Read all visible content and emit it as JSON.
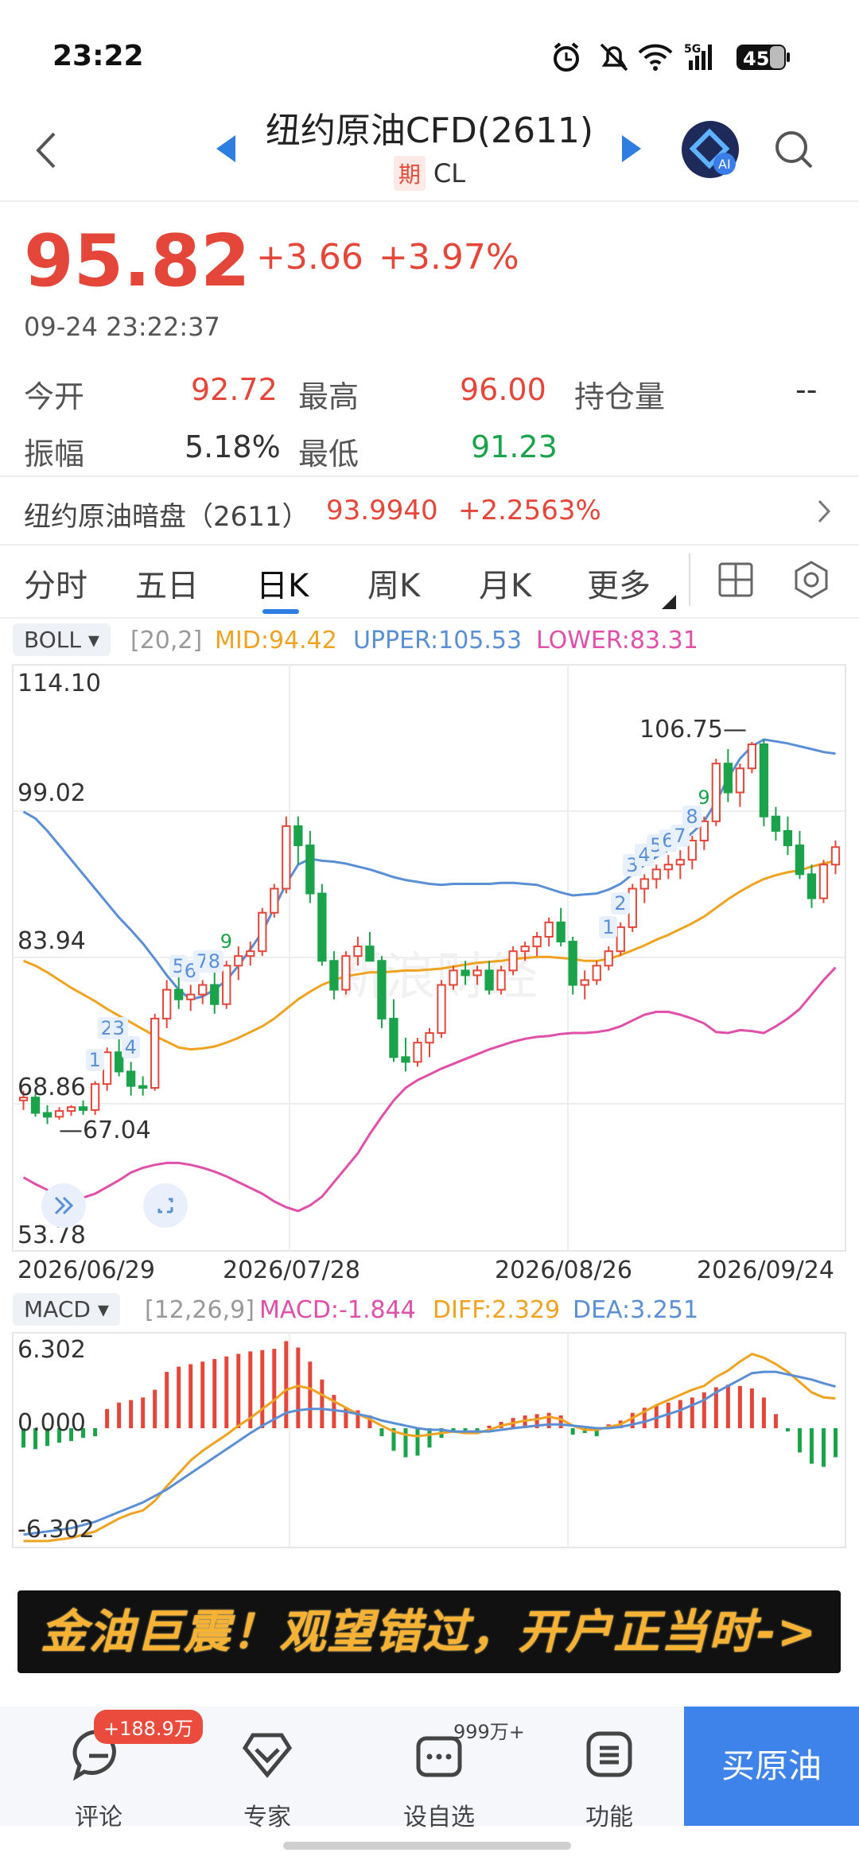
{
  "status_bar": {
    "time": "23:22",
    "battery": "45",
    "network": "5G"
  },
  "header": {
    "title": "纽约原油CFD(2611)",
    "tag": "期",
    "symbol": "CL"
  },
  "quote": {
    "price": "95.82",
    "change": "+3.66",
    "change_pct": "+3.97%",
    "timestamp": "09-24 23:22:37",
    "open_label": "今开",
    "open": "92.72",
    "high_label": "最高",
    "high": "96.00",
    "oi_label": "持仓量",
    "oi": "--",
    "amp_label": "振幅",
    "amp": "5.18%",
    "low_label": "最低",
    "low": "91.23"
  },
  "dark_pool": {
    "name": "纽约原油暗盘（2611）",
    "price": "93.9940",
    "change": "+2.2563%"
  },
  "tabs": [
    {
      "label": "分时"
    },
    {
      "label": "五日"
    },
    {
      "label": "日K"
    },
    {
      "label": "周K"
    },
    {
      "label": "月K"
    },
    {
      "label": "更多"
    }
  ],
  "boll": {
    "name": "BOLL",
    "params": "[20,2]",
    "mid": "MID:94.42",
    "upper": "UPPER:105.53",
    "lower": "LOWER:83.31"
  },
  "macd": {
    "name": "MACD",
    "params": "[12,26,9]",
    "macd": "MACD:-1.844",
    "diff": "DIFF:2.329",
    "dea": "DEA:3.251"
  },
  "colors": {
    "up": "#e5463a",
    "down": "#1aa34a",
    "upper": "#5a8fd6",
    "mid": "#efa321",
    "lower": "#e04fa8",
    "accent": "#2e7de0"
  },
  "chart_data": [
    {
      "type": "candlestick",
      "title": "",
      "y_ticks": [
        "114.10",
        "99.02",
        "83.94",
        "68.86",
        "53.78"
      ],
      "ylim": [
        53.78,
        114.1
      ],
      "dates": [
        "2026/06/29",
        "2026/07/28",
        "2026/08/26",
        "2026/09/24"
      ],
      "high_label": "106.75",
      "low_label": "67.04",
      "candles": [
        [
          69.5,
          70.5,
          68.5,
          69.8
        ],
        [
          69.8,
          70.2,
          67.8,
          68.2
        ],
        [
          68.2,
          69.0,
          67.04,
          67.8
        ],
        [
          67.8,
          68.8,
          67.5,
          68.4
        ],
        [
          68.4,
          69.0,
          67.9,
          68.8
        ],
        [
          68.8,
          69.5,
          68.0,
          68.5
        ],
        [
          68.5,
          71.5,
          68.0,
          71.2
        ],
        [
          71.2,
          75.0,
          70.5,
          74.5
        ],
        [
          74.5,
          76.0,
          72.0,
          72.5
        ],
        [
          72.5,
          73.5,
          70.0,
          71.0
        ],
        [
          71.0,
          72.0,
          70.0,
          70.8
        ],
        [
          70.8,
          78.5,
          70.5,
          78.0
        ],
        [
          78.0,
          82.0,
          77.0,
          81.0
        ],
        [
          81.0,
          82.5,
          79.0,
          80.0
        ],
        [
          80.0,
          81.5,
          78.8,
          80.5
        ],
        [
          80.5,
          82.0,
          79.5,
          81.5
        ],
        [
          81.5,
          83.0,
          78.5,
          79.5
        ],
        [
          79.5,
          84.0,
          79.0,
          83.5
        ],
        [
          83.5,
          85.5,
          82.0,
          84.5
        ],
        [
          84.5,
          86.0,
          83.5,
          85.0
        ],
        [
          85.0,
          89.5,
          84.5,
          89.0
        ],
        [
          89.0,
          92.0,
          88.5,
          91.5
        ],
        [
          91.5,
          99.0,
          91.0,
          98.0
        ],
        [
          98.0,
          99.0,
          94.0,
          96.0
        ],
        [
          96.0,
          97.5,
          90.0,
          91.0
        ],
        [
          91.0,
          92.0,
          83.5,
          84.0
        ],
        [
          84.0,
          85.0,
          80.0,
          81.0
        ],
        [
          81.0,
          85.0,
          80.5,
          84.5
        ],
        [
          84.5,
          86.5,
          83.5,
          85.5
        ],
        [
          85.5,
          87.0,
          84.0,
          84.0
        ],
        [
          84.0,
          84.5,
          77.0,
          78.0
        ],
        [
          78.0,
          80.0,
          73.5,
          74.0
        ],
        [
          74.0,
          76.0,
          72.5,
          73.5
        ],
        [
          73.5,
          76.0,
          73.0,
          75.5
        ],
        [
          75.5,
          77.0,
          74.0,
          76.5
        ],
        [
          76.5,
          82.0,
          76.0,
          81.5
        ],
        [
          81.5,
          83.5,
          81.0,
          83.0
        ],
        [
          83.0,
          84.0,
          81.5,
          82.5
        ],
        [
          82.5,
          83.5,
          81.5,
          83.0
        ],
        [
          83.0,
          84.0,
          80.5,
          81.0
        ],
        [
          81.0,
          83.5,
          80.5,
          83.0
        ],
        [
          83.0,
          85.5,
          82.5,
          85.0
        ],
        [
          85.0,
          86.0,
          84.0,
          85.5
        ],
        [
          85.5,
          87.0,
          84.5,
          86.5
        ],
        [
          86.5,
          88.5,
          85.5,
          88.0
        ],
        [
          88.0,
          89.5,
          85.5,
          86.0
        ],
        [
          86.0,
          86.5,
          80.5,
          81.5
        ],
        [
          81.5,
          83.0,
          80.0,
          82.0
        ],
        [
          82.0,
          84.0,
          81.5,
          83.5
        ],
        [
          83.5,
          85.5,
          83.0,
          85.0
        ],
        [
          85.0,
          88.0,
          84.5,
          87.5
        ],
        [
          87.5,
          92.0,
          87.0,
          91.5
        ],
        [
          91.5,
          93.0,
          90.0,
          92.5
        ],
        [
          92.5,
          94.0,
          91.5,
          93.5
        ],
        [
          93.5,
          95.0,
          92.5,
          94.0
        ],
        [
          94.0,
          95.5,
          92.5,
          94.5
        ],
        [
          94.5,
          97.0,
          93.5,
          96.5
        ],
        [
          96.5,
          99.0,
          95.5,
          98.5
        ],
        [
          98.5,
          105.0,
          98.0,
          104.5
        ],
        [
          104.5,
          106.0,
          100.5,
          101.5
        ],
        [
          101.5,
          104.5,
          100.0,
          104.0
        ],
        [
          104.0,
          106.75,
          103.5,
          106.5
        ],
        [
          106.5,
          107.0,
          98.0,
          99.0
        ],
        [
          99.0,
          100.0,
          96.5,
          97.5
        ],
        [
          97.5,
          99.0,
          95.0,
          96.0
        ],
        [
          96.0,
          97.5,
          92.5,
          93.0
        ],
        [
          93.0,
          94.0,
          89.5,
          90.5
        ],
        [
          90.5,
          94.5,
          90.0,
          94.0
        ],
        [
          94.0,
          96.5,
          93.0,
          95.82
        ]
      ],
      "upper": [
        99.5,
        98.8,
        97.5,
        96.0,
        94.5,
        93.0,
        91.5,
        90.0,
        88.5,
        87.2,
        85.8,
        84.2,
        82.5,
        81.0,
        80.0,
        80.3,
        81.0,
        82.0,
        83.5,
        85.2,
        87.0,
        89.5,
        92.0,
        94.0,
        94.6,
        94.4,
        94.3,
        94.1,
        93.8,
        93.5,
        93.1,
        92.7,
        92.4,
        92.2,
        92.0,
        91.9,
        92.0,
        92.0,
        92.0,
        92.0,
        92.1,
        92.1,
        92.0,
        91.9,
        91.5,
        91.1,
        90.8,
        90.9,
        91.0,
        91.4,
        92.0,
        93.0,
        94.0,
        94.8,
        95.5,
        96.3,
        97.3,
        98.5,
        100.5,
        103.0,
        105.0,
        106.3,
        107.0,
        106.8,
        106.6,
        106.3,
        106.0,
        105.7,
        105.53
      ],
      "mid": [
        84.0,
        83.5,
        82.8,
        82.0,
        81.2,
        80.5,
        79.8,
        79.0,
        78.3,
        77.6,
        76.9,
        76.2,
        75.6,
        75.0,
        74.8,
        74.9,
        75.1,
        75.5,
        76.0,
        76.6,
        77.2,
        78.0,
        79.0,
        80.0,
        80.8,
        81.5,
        82.0,
        82.4,
        82.6,
        82.8,
        82.8,
        82.9,
        83.0,
        83.0,
        83.1,
        83.2,
        83.4,
        83.6,
        83.8,
        83.9,
        84.0,
        84.2,
        84.3,
        84.4,
        84.4,
        84.3,
        84.2,
        84.0,
        84.0,
        84.2,
        84.6,
        85.1,
        85.6,
        86.2,
        86.7,
        87.3,
        87.9,
        88.6,
        89.5,
        90.4,
        91.2,
        91.9,
        92.5,
        92.9,
        93.2,
        93.4,
        93.8,
        94.1,
        94.42
      ],
      "lower": [
        61.5,
        60.8,
        60.2,
        59.6,
        59.3,
        59.4,
        59.8,
        60.5,
        61.2,
        62.0,
        62.5,
        62.8,
        63.0,
        63.0,
        62.8,
        62.5,
        62.1,
        61.6,
        61.0,
        60.4,
        59.8,
        59.0,
        58.4,
        58.0,
        58.6,
        59.5,
        61.0,
        62.5,
        64.0,
        66.0,
        67.8,
        69.5,
        70.8,
        71.6,
        72.2,
        72.8,
        73.3,
        73.8,
        74.3,
        74.8,
        75.2,
        75.6,
        75.9,
        76.1,
        76.2,
        76.4,
        76.5,
        76.5,
        76.6,
        76.8,
        77.2,
        77.8,
        78.4,
        78.7,
        78.7,
        78.4,
        78.0,
        77.5,
        76.6,
        76.5,
        76.8,
        76.7,
        76.5,
        77.2,
        78.0,
        79.0,
        80.5,
        82.0,
        83.31
      ]
    },
    {
      "type": "bar",
      "title": "",
      "y_ticks": [
        "6.302",
        "0.000",
        "-6.302"
      ],
      "ylim": [
        -6.302,
        6.302
      ],
      "hist": [
        -1.2,
        -1.3,
        -1.1,
        -0.9,
        -0.8,
        -0.6,
        -0.5,
        1.5,
        2.0,
        2.2,
        2.4,
        3.0,
        4.4,
        4.8,
        5.0,
        5.2,
        5.4,
        5.6,
        5.8,
        6.0,
        6.1,
        6.2,
        6.8,
        6.3,
        5.2,
        3.8,
        2.6,
        1.6,
        1.4,
        1.0,
        -0.5,
        -1.4,
        -1.8,
        -1.7,
        -1.2,
        -0.6,
        -0.2,
        -0.2,
        -0.3,
        0.2,
        0.5,
        0.8,
        1.0,
        1.1,
        1.2,
        1.0,
        -0.4,
        -0.3,
        -0.5,
        0.3,
        0.6,
        1.2,
        1.6,
        1.8,
        2.0,
        2.2,
        2.4,
        2.8,
        3.2,
        3.4,
        3.3,
        3.1,
        2.4,
        1.1,
        -0.2,
        -1.5,
        -2.2,
        -2.4,
        -1.8
      ],
      "diff": [
        -7.0,
        -7.0,
        -7.0,
        -6.9,
        -6.8,
        -6.6,
        -6.4,
        -6.0,
        -5.6,
        -5.3,
        -5.1,
        -4.5,
        -3.6,
        -2.8,
        -2.0,
        -1.4,
        -0.9,
        -0.4,
        0.2,
        0.8,
        1.5,
        2.2,
        3.0,
        3.3,
        3.1,
        2.6,
        2.1,
        1.6,
        1.1,
        0.7,
        0.2,
        -0.2,
        -0.4,
        -0.5,
        -0.4,
        -0.3,
        -0.2,
        -0.3,
        -0.3,
        -0.1,
        0.2,
        0.4,
        0.6,
        0.7,
        0.9,
        0.7,
        0.2,
        -0.1,
        -0.1,
        0.1,
        0.3,
        0.8,
        1.3,
        1.8,
        2.2,
        2.6,
        3.0,
        3.3,
        4.0,
        4.5,
        5.2,
        5.8,
        5.5,
        5.0,
        4.4,
        3.6,
        2.8,
        2.4,
        2.33
      ],
      "dea": [
        -6.6,
        -6.5,
        -6.4,
        -6.3,
        -6.2,
        -6.0,
        -5.8,
        -5.5,
        -5.2,
        -4.9,
        -4.6,
        -4.2,
        -3.8,
        -3.3,
        -2.8,
        -2.3,
        -1.8,
        -1.3,
        -0.8,
        -0.3,
        0.2,
        0.7,
        1.2,
        1.4,
        1.5,
        1.5,
        1.4,
        1.3,
        1.1,
        0.9,
        0.6,
        0.4,
        0.2,
        0.0,
        -0.1,
        -0.1,
        -0.2,
        -0.2,
        -0.2,
        -0.2,
        -0.1,
        0.0,
        0.1,
        0.2,
        0.3,
        0.3,
        0.2,
        0.1,
        0.0,
        0.0,
        0.1,
        0.3,
        0.5,
        0.8,
        1.1,
        1.4,
        1.8,
        2.2,
        2.8,
        3.3,
        3.8,
        4.3,
        4.4,
        4.4,
        4.2,
        4.0,
        3.8,
        3.5,
        3.25
      ]
    }
  ],
  "banner": {
    "text": "金油巨震！观望错过，开户正当时->"
  },
  "bottom_nav": {
    "comment": "评论",
    "comment_badge": "+188.9万",
    "expert": "专家",
    "watch": "设自选",
    "watch_badge": "999万+",
    "func": "功能",
    "buy": "买原油"
  }
}
